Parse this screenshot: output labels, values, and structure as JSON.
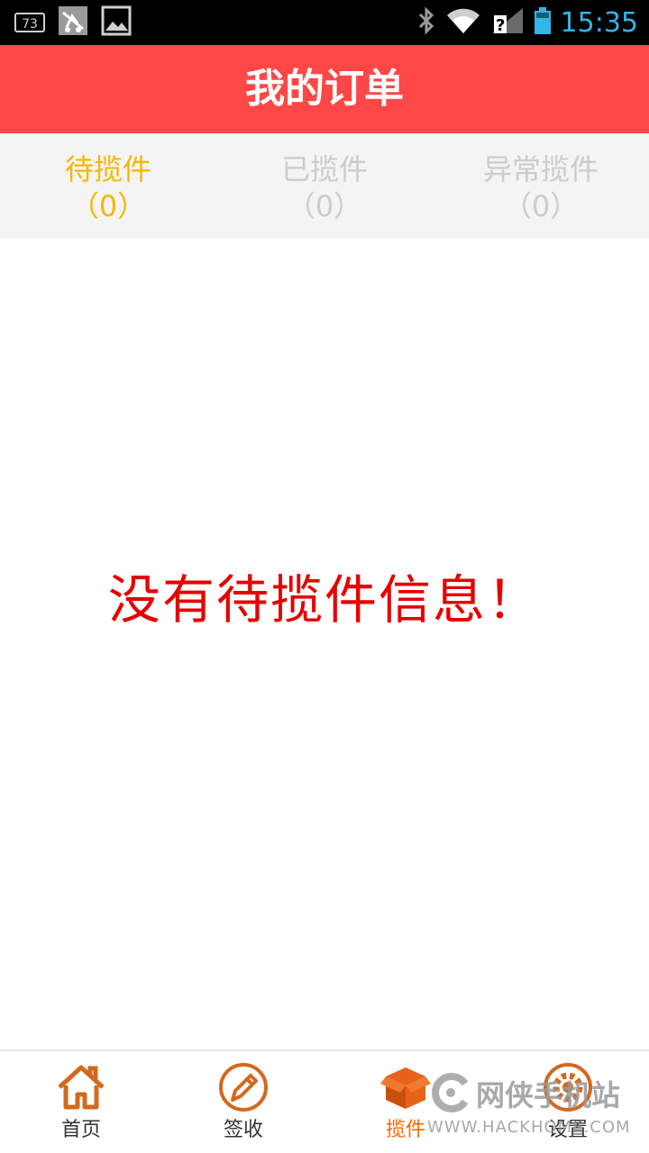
{
  "status_bar": {
    "notification_count": "73",
    "icons_left": [
      "sim-notification-icon",
      "mute-notification-icon",
      "image-notification-icon"
    ],
    "icons_right": [
      "bluetooth-icon",
      "wifi-icon",
      "signal-icon",
      "battery-icon"
    ],
    "time": "15:35",
    "clock_color": "#33b5e5"
  },
  "header": {
    "title": "我的订单",
    "color": "#ff4747"
  },
  "tabs": [
    {
      "label": "待揽件",
      "count": "（0）",
      "active": true
    },
    {
      "label": "已揽件",
      "count": "（0）",
      "active": false
    },
    {
      "label": "异常揽件",
      "count": "（0）",
      "active": false
    }
  ],
  "tab_colors": {
    "active": "#f5b800",
    "inactive": "#cccccc"
  },
  "main": {
    "empty_message": "没有待揽件信息！",
    "empty_color": "#e60000"
  },
  "bottom_nav": {
    "items": [
      {
        "label": "首页",
        "icon": "home-icon",
        "active": false
      },
      {
        "label": "签收",
        "icon": "pencil-circle-icon",
        "active": false
      },
      {
        "label": "揽件",
        "icon": "package-box-icon",
        "active": true
      },
      {
        "label": "设置",
        "icon": "gear-icon",
        "active": false
      }
    ],
    "accent": "#ff6600",
    "icon_color": "#d2691e"
  },
  "watermark": {
    "text": "网侠手机站",
    "url": "WWW.HACKHOME.COM"
  }
}
